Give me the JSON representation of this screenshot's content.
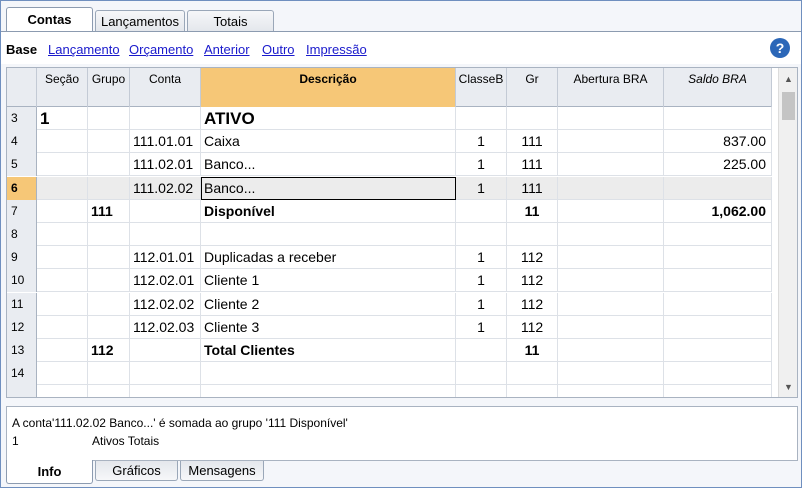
{
  "top_tabs": [
    "Contas",
    "Lançamentos",
    "Totais"
  ],
  "views": {
    "base": "Base",
    "links": [
      "Lançamento",
      "Orçamento",
      "Anterior",
      "Outro",
      "Impressão"
    ]
  },
  "help": "?",
  "columns": [
    "Seção",
    "Grupo",
    "Conta",
    "Descrição",
    "ClasseB",
    "Gr",
    "Abertura BRA",
    "Saldo BRA"
  ],
  "rows": [
    {
      "n": "3",
      "secao": "1",
      "grupo": "",
      "conta": "",
      "desc": "ATIVO",
      "classe": "",
      "gr": "",
      "abertura": "",
      "saldo": ""
    },
    {
      "n": "4",
      "secao": "",
      "grupo": "",
      "conta": "111.01.01",
      "desc": "Caixa",
      "classe": "1",
      "gr": "111",
      "abertura": "",
      "saldo": "837.00"
    },
    {
      "n": "5",
      "secao": "",
      "grupo": "",
      "conta": "111.02.01",
      "desc": "Banco...",
      "classe": "1",
      "gr": "111",
      "abertura": "",
      "saldo": "225.00"
    },
    {
      "n": "6",
      "secao": "",
      "grupo": "",
      "conta": "111.02.02",
      "desc": "Banco...",
      "classe": "1",
      "gr": "111",
      "abertura": "",
      "saldo": ""
    },
    {
      "n": "7",
      "secao": "",
      "grupo": "111",
      "conta": "",
      "desc": "Disponível",
      "classe": "",
      "gr": "11",
      "abertura": "",
      "saldo": "1,062.00"
    },
    {
      "n": "8",
      "secao": "",
      "grupo": "",
      "conta": "",
      "desc": "",
      "classe": "",
      "gr": "",
      "abertura": "",
      "saldo": ""
    },
    {
      "n": "9",
      "secao": "",
      "grupo": "",
      "conta": "112.01.01",
      "desc": "Duplicadas a receber",
      "classe": "1",
      "gr": "112",
      "abertura": "",
      "saldo": ""
    },
    {
      "n": "10",
      "secao": "",
      "grupo": "",
      "conta": "112.02.01",
      "desc": "Cliente 1",
      "classe": "1",
      "gr": "112",
      "abertura": "",
      "saldo": ""
    },
    {
      "n": "11",
      "secao": "",
      "grupo": "",
      "conta": "112.02.02",
      "desc": "Cliente 2",
      "classe": "1",
      "gr": "112",
      "abertura": "",
      "saldo": ""
    },
    {
      "n": "12",
      "secao": "",
      "grupo": "",
      "conta": "112.02.03",
      "desc": "Cliente 3",
      "classe": "1",
      "gr": "112",
      "abertura": "",
      "saldo": ""
    },
    {
      "n": "13",
      "secao": "",
      "grupo": "112",
      "conta": "",
      "desc": "Total Clientes",
      "classe": "",
      "gr": "11",
      "abertura": "",
      "saldo": ""
    },
    {
      "n": "14",
      "secao": "",
      "grupo": "",
      "conta": "",
      "desc": "",
      "classe": "",
      "gr": "",
      "abertura": "",
      "saldo": ""
    },
    {
      "n": "",
      "secao": "",
      "grupo": "",
      "conta": "",
      "desc": "",
      "classe": "",
      "gr": "",
      "abertura": "",
      "saldo": ""
    }
  ],
  "info": {
    "line1": "A conta'111.02.02 Banco...' é somada ao grupo '111 Disponível'",
    "line2_num": "1",
    "line2_text": "Ativos Totais"
  },
  "bottom_tabs": [
    "Info",
    "Gráficos",
    "Mensagens"
  ],
  "colors": {
    "accent": "#f6c777",
    "link": "#1a1acc",
    "header": "#e9ecf1"
  }
}
